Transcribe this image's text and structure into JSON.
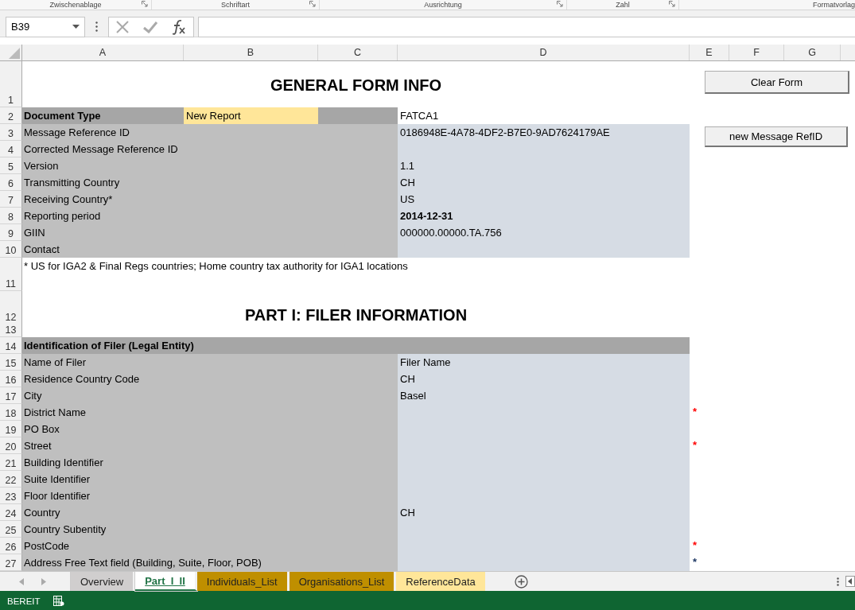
{
  "ribbon_groups": [
    {
      "label": "Zwischenablage",
      "launcher": true
    },
    {
      "label": "Schriftart",
      "launcher": true
    },
    {
      "label": "Ausrichtung",
      "launcher": true
    },
    {
      "label": "Zahl",
      "launcher": true
    },
    {
      "label": "Formatvorlag",
      "launcher": false
    }
  ],
  "formula_bar": {
    "name_box": "B39"
  },
  "columns": [
    "A",
    "B",
    "C",
    "D",
    "E",
    "F",
    "G"
  ],
  "rows": [
    {
      "number": "1",
      "kind": "title",
      "text": "GENERAL FORM INFO"
    },
    {
      "number": "2",
      "kind": "doctype",
      "label": "Document Type",
      "selection": "New Report",
      "value": "FATCA1"
    },
    {
      "number": "3",
      "kind": "field",
      "label": "Message Reference ID",
      "value": "0186948E-4A78-4DF2-B7E0-9AD7624179AE"
    },
    {
      "number": "4",
      "kind": "field",
      "label": "Corrected Message Reference ID"
    },
    {
      "number": "5",
      "kind": "field",
      "label": "Version",
      "value": "1.1"
    },
    {
      "number": "6",
      "kind": "field",
      "label": "Transmitting Country",
      "value": "CH"
    },
    {
      "number": "7",
      "kind": "field",
      "label": "Receiving Country*",
      "value": "US"
    },
    {
      "number": "8",
      "kind": "field",
      "label": "Reporting period",
      "value": "2014-12-31",
      "emphasis": true
    },
    {
      "number": "9",
      "kind": "field",
      "label": "GIIN",
      "value": "000000.00000.TA.756"
    },
    {
      "number": "10",
      "kind": "field",
      "label": "Contact"
    },
    {
      "number": "11",
      "kind": "note",
      "text": "* US for IGA2 & Final Regs countries; Home country tax authority for IGA1 locations"
    },
    {
      "number": "12",
      "kind": "title",
      "text": "PART I: FILER INFORMATION"
    },
    {
      "number": "13",
      "kind": "blank"
    },
    {
      "number": "14",
      "kind": "header",
      "label": "Identification of Filer (Legal Entity)"
    },
    {
      "number": "15",
      "kind": "field",
      "label": "Name of Filer",
      "value": "Filer Name"
    },
    {
      "number": "16",
      "kind": "field",
      "label": "Residence Country Code",
      "value": "CH"
    },
    {
      "number": "17",
      "kind": "field",
      "label": "City",
      "value": "Basel"
    },
    {
      "number": "18",
      "kind": "field",
      "label": "District Name",
      "marker": {
        "text": "*",
        "color": "#ff0000"
      }
    },
    {
      "number": "19",
      "kind": "field",
      "label": "PO Box"
    },
    {
      "number": "20",
      "kind": "field",
      "label": "Street",
      "marker": {
        "text": "*",
        "color": "#ff0000"
      }
    },
    {
      "number": "21",
      "kind": "field",
      "label": "Building Identifier"
    },
    {
      "number": "22",
      "kind": "field",
      "label": "Suite Identifier"
    },
    {
      "number": "23",
      "kind": "field",
      "label": "Floor Identifier"
    },
    {
      "number": "24",
      "kind": "field",
      "label": "Country",
      "value": "CH"
    },
    {
      "number": "25",
      "kind": "field",
      "label": "Country Subentity"
    },
    {
      "number": "26",
      "kind": "field",
      "label": "PostCode",
      "marker": {
        "text": "*",
        "color": "#ff0000"
      }
    },
    {
      "number": "27",
      "kind": "field",
      "label": "Address Free Text field (Building, Suite, Floor, POB)",
      "marker": {
        "text": "*",
        "color": "#1f3864"
      }
    }
  ],
  "buttons": [
    "Clear Form",
    "new Message RefID"
  ],
  "sheet_tabs": [
    {
      "label": "Overview",
      "selected": false,
      "color": "#d0cece"
    },
    {
      "label": "Part_I_II",
      "selected": true,
      "color": "#ffffff"
    },
    {
      "label": "Individuals_List",
      "selected": false,
      "color": "#bf8f00"
    },
    {
      "label": "Organisations_List",
      "selected": false,
      "color": "#bf8f00"
    },
    {
      "label": "ReferenceData",
      "selected": false,
      "color": "#ffe699"
    }
  ],
  "status_bar": {
    "mode": "BEREIT"
  }
}
